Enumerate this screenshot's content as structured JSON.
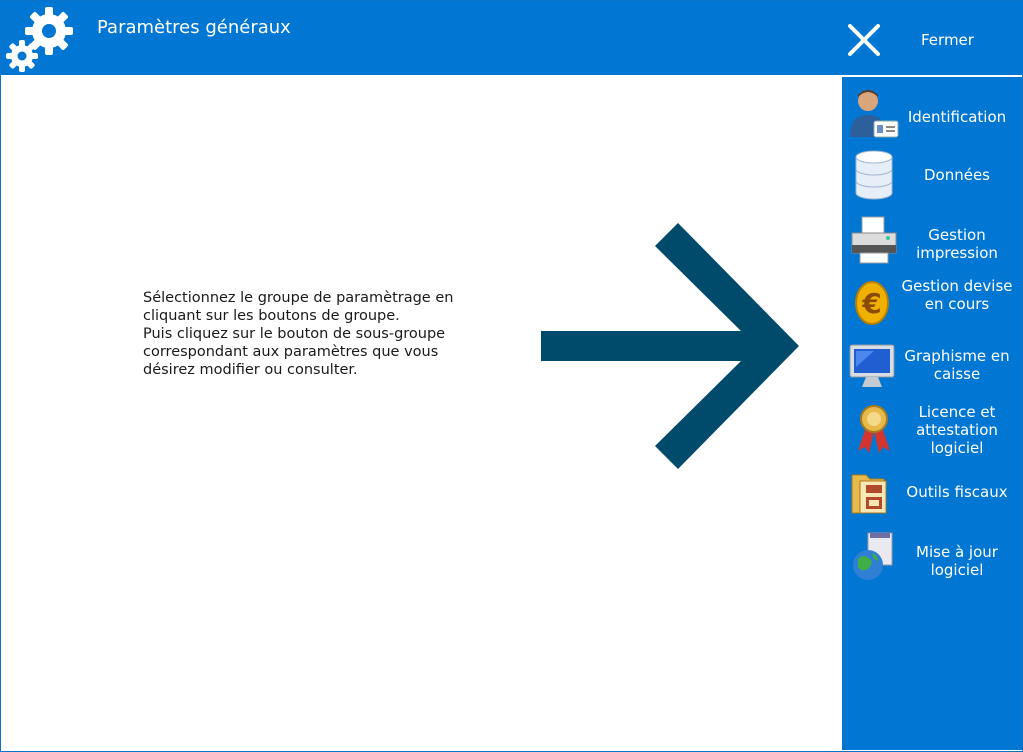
{
  "window": {
    "title": "Paramètres généraux",
    "app_icon": "gears-icon",
    "close_label": "Fermer",
    "close_icon": "close-icon"
  },
  "instructions": {
    "line1": "Sélectionnez le groupe de paramètrage en\ncliquant sur les boutons de groupe.",
    "line2": "Puis cliquez sur le bouton de sous-groupe\ncorrespondant aux paramètres que vous\ndésirez modifier ou consulter.",
    "arrow_icon": "right-arrow-icon"
  },
  "sidebar": {
    "items": [
      {
        "label": "Identification",
        "icon": "user-id-card-icon"
      },
      {
        "label": "Données",
        "icon": "database-icon"
      },
      {
        "label": "Gestion impression",
        "icon": "printer-icon"
      },
      {
        "label": "Gestion devise en cours",
        "icon": "euro-coin-icon"
      },
      {
        "label": "Graphisme en caisse",
        "icon": "monitor-icon"
      },
      {
        "label": "Licence et attestation logiciel",
        "icon": "ribbon-award-icon"
      },
      {
        "label": "Outils fiscaux",
        "icon": "folder-documents-icon"
      },
      {
        "label": "Mise à jour logiciel",
        "icon": "globe-update-icon"
      }
    ]
  },
  "colors": {
    "titlebar": "#0176d3",
    "sidebar": "#0176d3",
    "arrow": "#004a6b",
    "text": "#1a1a1a"
  }
}
